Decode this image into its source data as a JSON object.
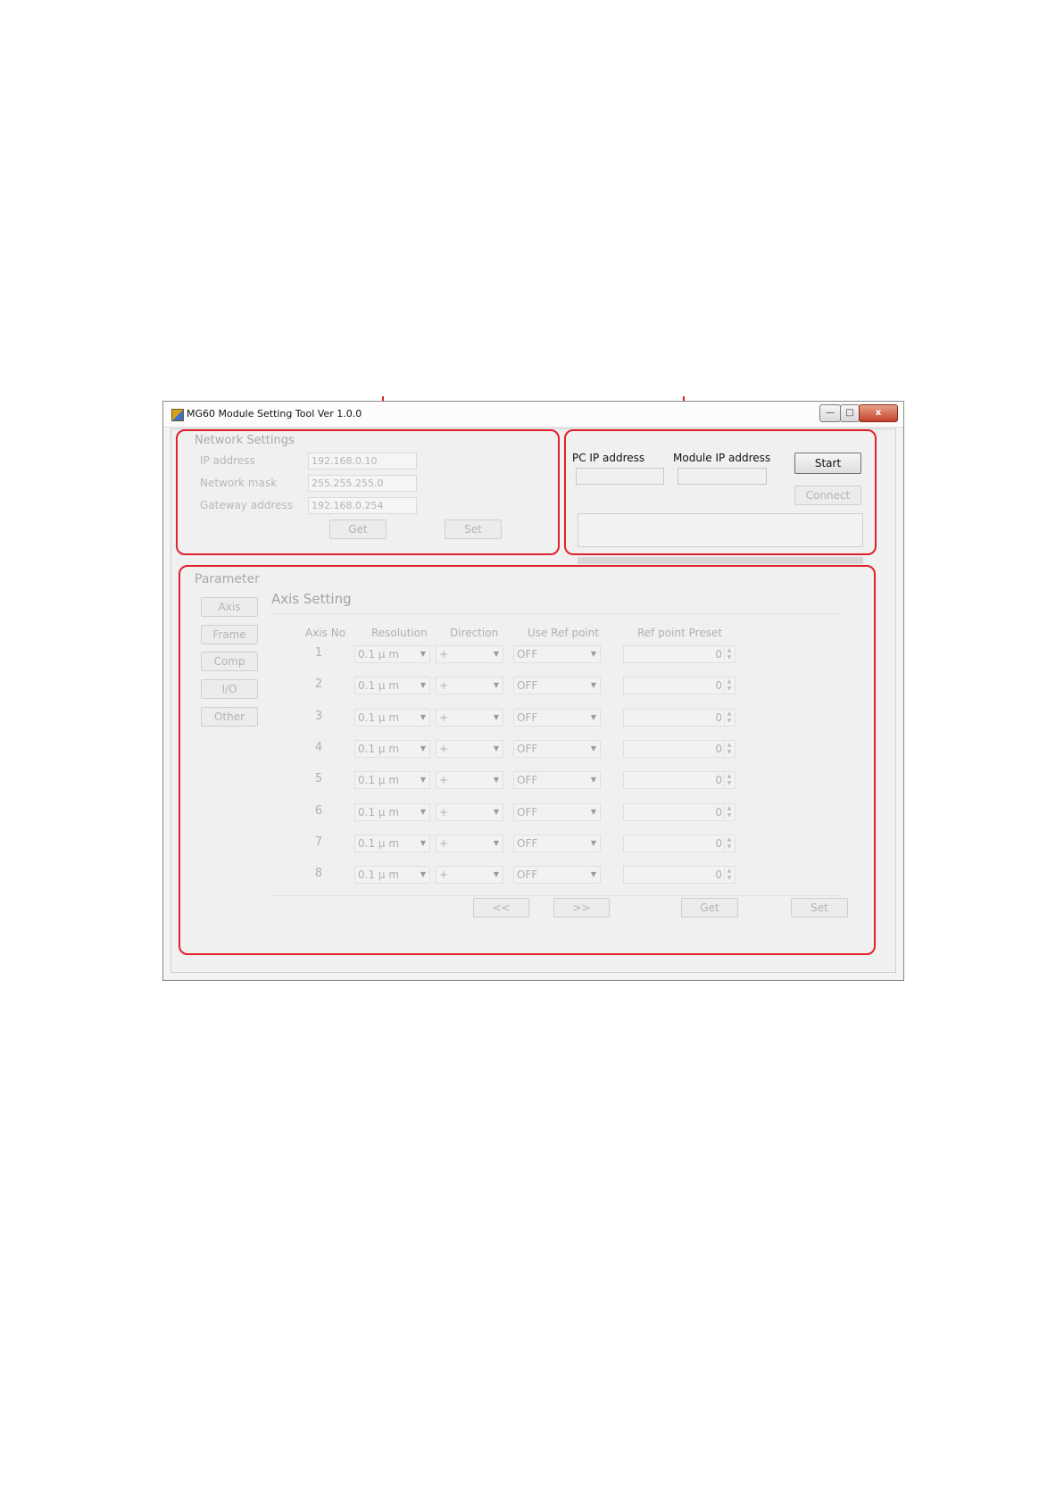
{
  "window": {
    "title": "MG60 Module Setting Tool Ver 1.0.0",
    "controls": {
      "minimize": "—",
      "maximize": "□",
      "close": "x"
    }
  },
  "network": {
    "group_title": "Network Settings",
    "ip_label": "IP address",
    "ip_value": "192.168.0.10",
    "mask_label": "Network mask",
    "mask_value": "255.255.255.0",
    "gateway_label": "Gateway address",
    "gateway_value": "192.168.0.254",
    "get_label": "Get",
    "set_label": "Set"
  },
  "connection": {
    "pc_ip_label": "PC IP address",
    "module_ip_label": "Module IP address",
    "pc_ip_value": "",
    "module_ip_value": "",
    "start_label": "Start",
    "connect_label": "Connect"
  },
  "parameter": {
    "group_title": "Parameter",
    "tabs": [
      "Axis",
      "Frame",
      "Comp",
      "I/O",
      "Other"
    ],
    "section_title": "Axis Setting",
    "headers": {
      "axis_no": "Axis No",
      "resolution": "Resolution",
      "direction": "Direction",
      "use_ref": "Use Ref point",
      "ref_preset": "Ref point Preset"
    },
    "rows": [
      {
        "no": "1",
        "resolution": "0.1 μ m",
        "direction": "+",
        "use_ref": "OFF",
        "preset": "0"
      },
      {
        "no": "2",
        "resolution": "0.1 μ m",
        "direction": "+",
        "use_ref": "OFF",
        "preset": "0"
      },
      {
        "no": "3",
        "resolution": "0.1 μ m",
        "direction": "+",
        "use_ref": "OFF",
        "preset": "0"
      },
      {
        "no": "4",
        "resolution": "0.1 μ m",
        "direction": "+",
        "use_ref": "OFF",
        "preset": "0"
      },
      {
        "no": "5",
        "resolution": "0.1 μ m",
        "direction": "+",
        "use_ref": "OFF",
        "preset": "0"
      },
      {
        "no": "6",
        "resolution": "0.1 μ m",
        "direction": "+",
        "use_ref": "OFF",
        "preset": "0"
      },
      {
        "no": "7",
        "resolution": "0.1 μ m",
        "direction": "+",
        "use_ref": "OFF",
        "preset": "0"
      },
      {
        "no": "8",
        "resolution": "0.1 μ m",
        "direction": "+",
        "use_ref": "OFF",
        "preset": "0"
      }
    ],
    "prev_label": "<<",
    "next_label": ">>",
    "get_label": "Get",
    "set_label": "Set"
  },
  "annotation_color": "#e0212b"
}
